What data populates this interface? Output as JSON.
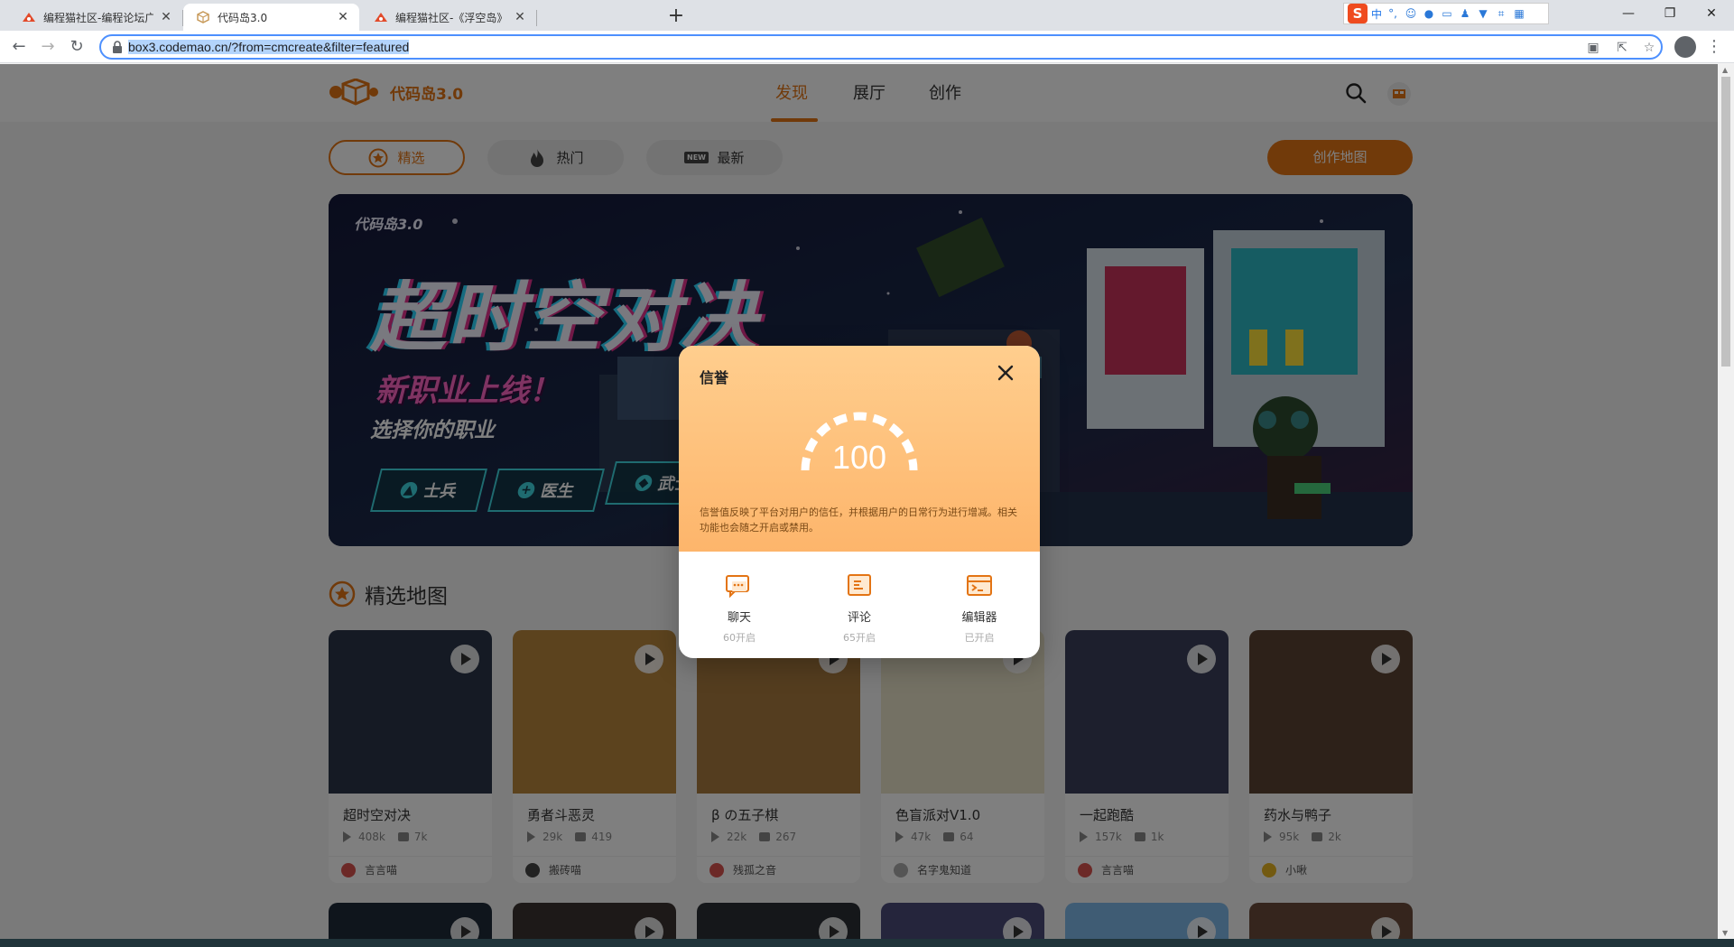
{
  "browser": {
    "tabs": [
      {
        "title": "编程猫社区-编程论坛广场-编程学",
        "active": false
      },
      {
        "title": "代码岛3.0",
        "active": true
      },
      {
        "title": "编程猫社区-《浮空岛》开肝！！",
        "active": false
      }
    ],
    "url_highlighted": "box3.codemao.cn/?from=cmcreate&filter=featured",
    "new_tab": "+",
    "window_buttons": [
      "—",
      "❐",
      "✕"
    ],
    "ime_label": "中"
  },
  "site": {
    "brand": "代码岛3.0",
    "nav": [
      "发现",
      "展厅",
      "创作"
    ],
    "active_nav": "发现"
  },
  "filters": [
    "精选",
    "热门",
    "最新"
  ],
  "new_badge": "NEW",
  "create_button": "创作地图",
  "banner": {
    "brand": "代码岛3.0",
    "title": "超时空对决",
    "subtitle": "新职业上线！",
    "tagline": "选择你的职业",
    "jobs": [
      "士兵",
      "医生",
      "武士"
    ]
  },
  "section_title": "精选地图",
  "maps": [
    {
      "title": "超时空对决",
      "plays": "408k",
      "comments": "7k",
      "author": "言言喵",
      "thumb_color": "#2a3448",
      "avatar_color": "#d9534f"
    },
    {
      "title": "勇者斗恶灵",
      "plays": "29k",
      "comments": "419",
      "author": "搬砖喵",
      "thumb_color": "#b8863c",
      "avatar_color": "#444444"
    },
    {
      "title": "β の五子棋",
      "plays": "22k",
      "comments": "267",
      "author": "残孤之音",
      "thumb_color": "#a87a3e",
      "avatar_color": "#d9534f"
    },
    {
      "title": "色盲派对V1.0",
      "plays": "47k",
      "comments": "64",
      "author": "名字鬼知道",
      "thumb_color": "#e9e2c8",
      "avatar_color": "#aaaaaa"
    },
    {
      "title": "一起跑酷",
      "plays": "157k",
      "comments": "1k",
      "author": "言言喵",
      "thumb_color": "#3a3f5a",
      "avatar_color": "#d9534f"
    },
    {
      "title": "药水与鸭子",
      "plays": "95k",
      "comments": "2k",
      "author": "小啾",
      "thumb_color": "#5a4232",
      "avatar_color": "#e6b422"
    }
  ],
  "second_row_colors": [
    "#1e2a38",
    "#3a3230",
    "#2a2e34",
    "#4a4a78",
    "#7fb8e8",
    "#6a4a3a"
  ],
  "modal": {
    "title": "信誉",
    "score": "100",
    "description": "信誉值反映了平台对用户的信任，并根据用户的日常行为进行增减。相关功能也会随之开启或禁用。",
    "features": [
      {
        "name": "聊天",
        "status": "60开启"
      },
      {
        "name": "评论",
        "status": "65开启"
      },
      {
        "name": "编辑器",
        "status": "已开启"
      }
    ]
  },
  "colors": {
    "accent": "#e37414",
    "modal_gradient_top": "#ffce8e",
    "modal_gradient_bottom": "#fdb56b"
  }
}
